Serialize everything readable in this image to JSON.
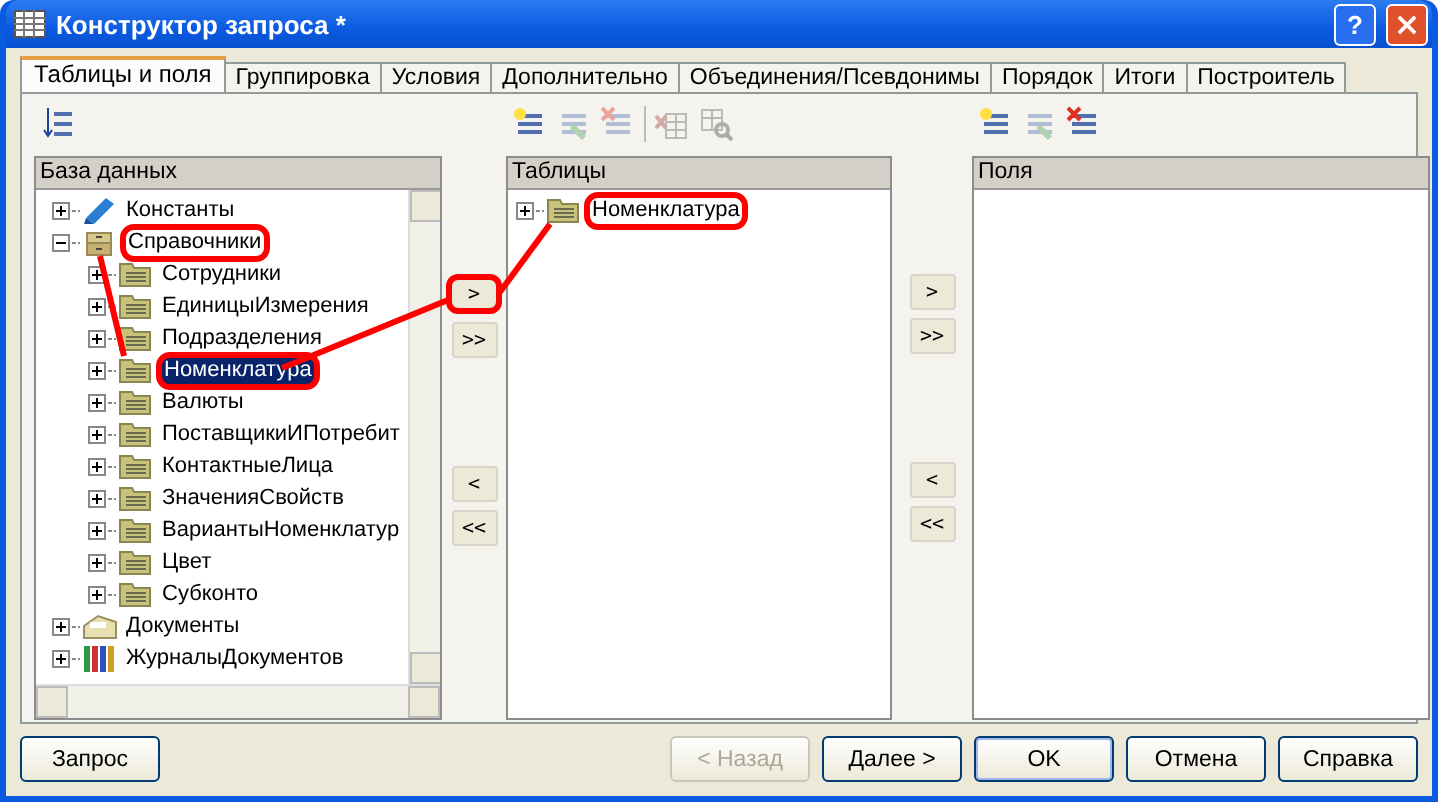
{
  "window": {
    "title": "Конструктор запроса *",
    "help_button": "?"
  },
  "tabs": [
    {
      "label": "Таблицы и поля",
      "selected": true
    },
    {
      "label": "Группировка",
      "selected": false
    },
    {
      "label": "Условия",
      "selected": false
    },
    {
      "label": "Дополнительно",
      "selected": false
    },
    {
      "label": "Объединения/Псевдонимы",
      "selected": false
    },
    {
      "label": "Порядок",
      "selected": false
    },
    {
      "label": "Итоги",
      "selected": false
    },
    {
      "label": "Построитель",
      "selected": false
    }
  ],
  "database_panel": {
    "toolbar": [
      {
        "kind": "hierarchy",
        "disabled": false
      }
    ],
    "header": "База данных",
    "tree": [
      {
        "label": "Константы",
        "kind": "constants",
        "expanded": false,
        "selected": false,
        "annotated": false
      },
      {
        "label": "Справочники",
        "kind": "catalogs",
        "expanded": true,
        "selected": false,
        "annotated": true,
        "children": [
          {
            "label": "Сотрудники",
            "kind": "table",
            "expanded": false,
            "selected": false,
            "annotated": false
          },
          {
            "label": "ЕдиницыИзмерения",
            "kind": "table",
            "expanded": false,
            "selected": false,
            "annotated": false
          },
          {
            "label": "Подразделения",
            "kind": "table",
            "expanded": false,
            "selected": false,
            "annotated": false
          },
          {
            "label": "Номенклатура",
            "kind": "table",
            "expanded": false,
            "selected": true,
            "annotated": true
          },
          {
            "label": "Валюты",
            "kind": "table",
            "expanded": false,
            "selected": false,
            "annotated": false
          },
          {
            "label": "ПоставщикиИПотребит",
            "kind": "table",
            "expanded": false,
            "selected": false,
            "annotated": false
          },
          {
            "label": "КонтактныеЛица",
            "kind": "table",
            "expanded": false,
            "selected": false,
            "annotated": false
          },
          {
            "label": "ЗначенияСвойств",
            "kind": "table",
            "expanded": false,
            "selected": false,
            "annotated": false
          },
          {
            "label": "ВариантыНоменклатур",
            "kind": "table",
            "expanded": false,
            "selected": false,
            "annotated": false
          },
          {
            "label": "Цвет",
            "kind": "table",
            "expanded": false,
            "selected": false,
            "annotated": false
          },
          {
            "label": "Субконто",
            "kind": "table",
            "expanded": false,
            "selected": false,
            "annotated": false
          }
        ]
      },
      {
        "label": "Документы",
        "kind": "documents",
        "expanded": false,
        "selected": false,
        "annotated": false
      },
      {
        "label": "ЖурналыДокументов",
        "kind": "journals",
        "expanded": false,
        "selected": false,
        "annotated": false
      }
    ]
  },
  "transfer_buttons_left": [
    {
      "label": ">",
      "annotated": true
    },
    {
      "label": ">>",
      "annotated": false
    },
    {
      "label": "<",
      "annotated": false
    },
    {
      "label": "<<",
      "annotated": false
    }
  ],
  "tables_panel": {
    "toolbar": [
      {
        "kind": "add",
        "disabled": false
      },
      {
        "kind": "edit",
        "disabled": true
      },
      {
        "kind": "delete",
        "disabled": true
      },
      {
        "kind": "separator"
      },
      {
        "kind": "check-table",
        "disabled": true
      },
      {
        "kind": "find-table",
        "disabled": true
      }
    ],
    "header": "Таблицы",
    "tree": [
      {
        "label": "Номенклатура",
        "kind": "table",
        "expanded": false,
        "selected": false,
        "annotated": true
      }
    ]
  },
  "transfer_buttons_right": [
    {
      "label": ">",
      "annotated": false
    },
    {
      "label": ">>",
      "annotated": false
    },
    {
      "label": "<",
      "annotated": false
    },
    {
      "label": "<<",
      "annotated": false
    }
  ],
  "fields_panel": {
    "toolbar": [
      {
        "kind": "add",
        "disabled": false
      },
      {
        "kind": "edit",
        "disabled": true
      },
      {
        "kind": "delete",
        "disabled": false
      }
    ],
    "header": "Поля"
  },
  "footer_buttons": [
    {
      "label": "Запрос",
      "disabled": false,
      "default": false
    },
    {
      "label": "< Назад",
      "disabled": true,
      "default": false
    },
    {
      "label": "Далее >",
      "disabled": false,
      "default": false
    },
    {
      "label": "OK",
      "disabled": false,
      "default": true
    },
    {
      "label": "Отмена",
      "disabled": false,
      "default": false
    },
    {
      "label": "Справка",
      "disabled": false,
      "default": false
    }
  ]
}
